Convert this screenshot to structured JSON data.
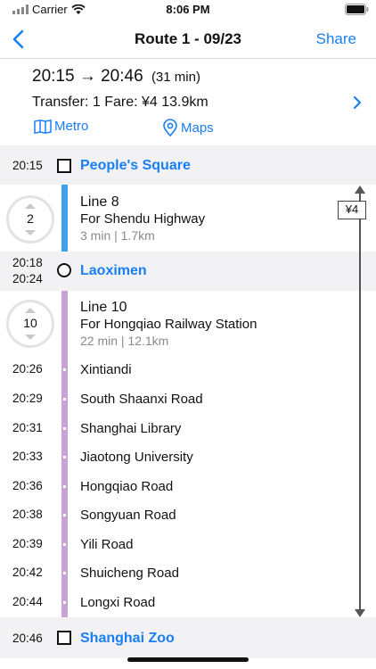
{
  "status_bar": {
    "carrier": "Carrier",
    "time": "8:06 PM"
  },
  "nav": {
    "title": "Route 1 - 09/23",
    "share_label": "Share"
  },
  "summary": {
    "depart": "20:15",
    "arrow": "→",
    "arrive": "20:46",
    "duration": "(31 min)",
    "details": "Transfer: 1  Fare: ¥4  13.9km",
    "metro_label": "Metro",
    "maps_label": "Maps"
  },
  "stations": {
    "start": {
      "time": "20:15",
      "name": "People's Square"
    },
    "transfer": {
      "arrive": "20:18",
      "depart": "20:24",
      "name": "Laoximen"
    },
    "end": {
      "time": "20:46",
      "name": "Shanghai Zoo"
    }
  },
  "legs": [
    {
      "number": "2",
      "line": "Line 8",
      "direction": "For Shendu Highway",
      "meta": "3 min  |  1.7km",
      "color": "#3da2ea"
    },
    {
      "number": "10",
      "line": "Line 10",
      "direction": "For Hongqiao Railway Station",
      "meta": "22 min  |  12.1km",
      "color": "#c7a3d6"
    }
  ],
  "stops": [
    {
      "time": "20:26",
      "name": "Xintiandi"
    },
    {
      "time": "20:29",
      "name": "South Shaanxi Road"
    },
    {
      "time": "20:31",
      "name": "Shanghai Library"
    },
    {
      "time": "20:33",
      "name": "Jiaotong University"
    },
    {
      "time": "20:36",
      "name": "Hongqiao Road"
    },
    {
      "time": "20:38",
      "name": "Songyuan Road"
    },
    {
      "time": "20:39",
      "name": "Yili Road"
    },
    {
      "time": "20:42",
      "name": "Shuicheng Road"
    },
    {
      "time": "20:44",
      "name": "Longxi Road"
    }
  ],
  "fare_badge": "¥4",
  "colors": {
    "accent": "#1a7ef5",
    "band": "#f2f2f4"
  }
}
